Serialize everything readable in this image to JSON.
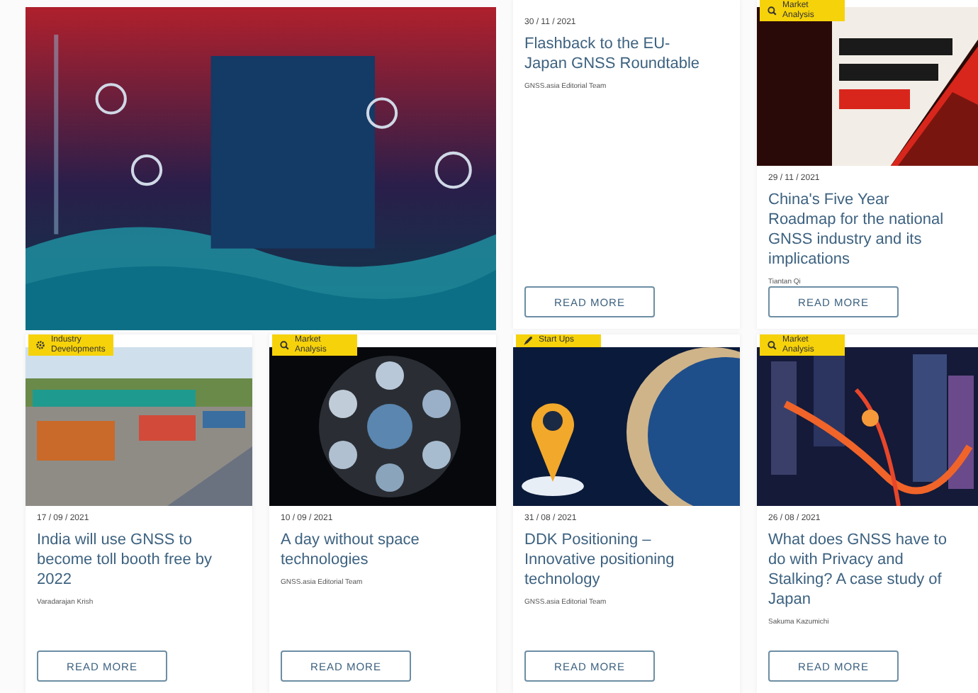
{
  "cards": [
    {
      "kind": "feature"
    },
    {
      "kind": "article",
      "date": "30 / 11 / 2021",
      "title": "Flashback to the EU-Japan GNSS Roundtable",
      "author": "GNSS.asia Editorial Team",
      "button": "READ MORE"
    },
    {
      "kind": "article",
      "tag": {
        "kind": "market",
        "label": "Market Analysis"
      },
      "date": "29 / 11 / 2021",
      "title": "China's Five Year Roadmap for the national GNSS industry and its implications",
      "author": "Tiantan Qi",
      "button": "READ MORE"
    },
    {
      "kind": "article",
      "tag": {
        "kind": "industry",
        "label": "Industry Developments"
      },
      "date": "17 / 09 / 2021",
      "title": "India will use GNSS to become toll booth free by 2022",
      "author": "Varadarajan Krish",
      "button": "READ MORE"
    },
    {
      "kind": "article",
      "tag": {
        "kind": "market",
        "label": "Market Analysis"
      },
      "date": "10 / 09 / 2021",
      "title": "A day without space technologies",
      "author": "GNSS.asia Editorial Team",
      "button": "READ MORE"
    },
    {
      "kind": "article",
      "tag": {
        "kind": "startup",
        "label": "Start Ups"
      },
      "date": "31 / 08 / 2021",
      "title": "DDK Positioning – Innovative positioning technology",
      "author": "GNSS.asia Editorial Team",
      "button": "READ MORE"
    },
    {
      "kind": "article",
      "tag": {
        "kind": "market",
        "label": "Market Analysis"
      },
      "date": "26 / 08 / 2021",
      "title": "What does GNSS have to do with Privacy and Stalking? A case study of Japan",
      "author": "Sakuma Kazumichi",
      "button": "READ MORE"
    }
  ]
}
